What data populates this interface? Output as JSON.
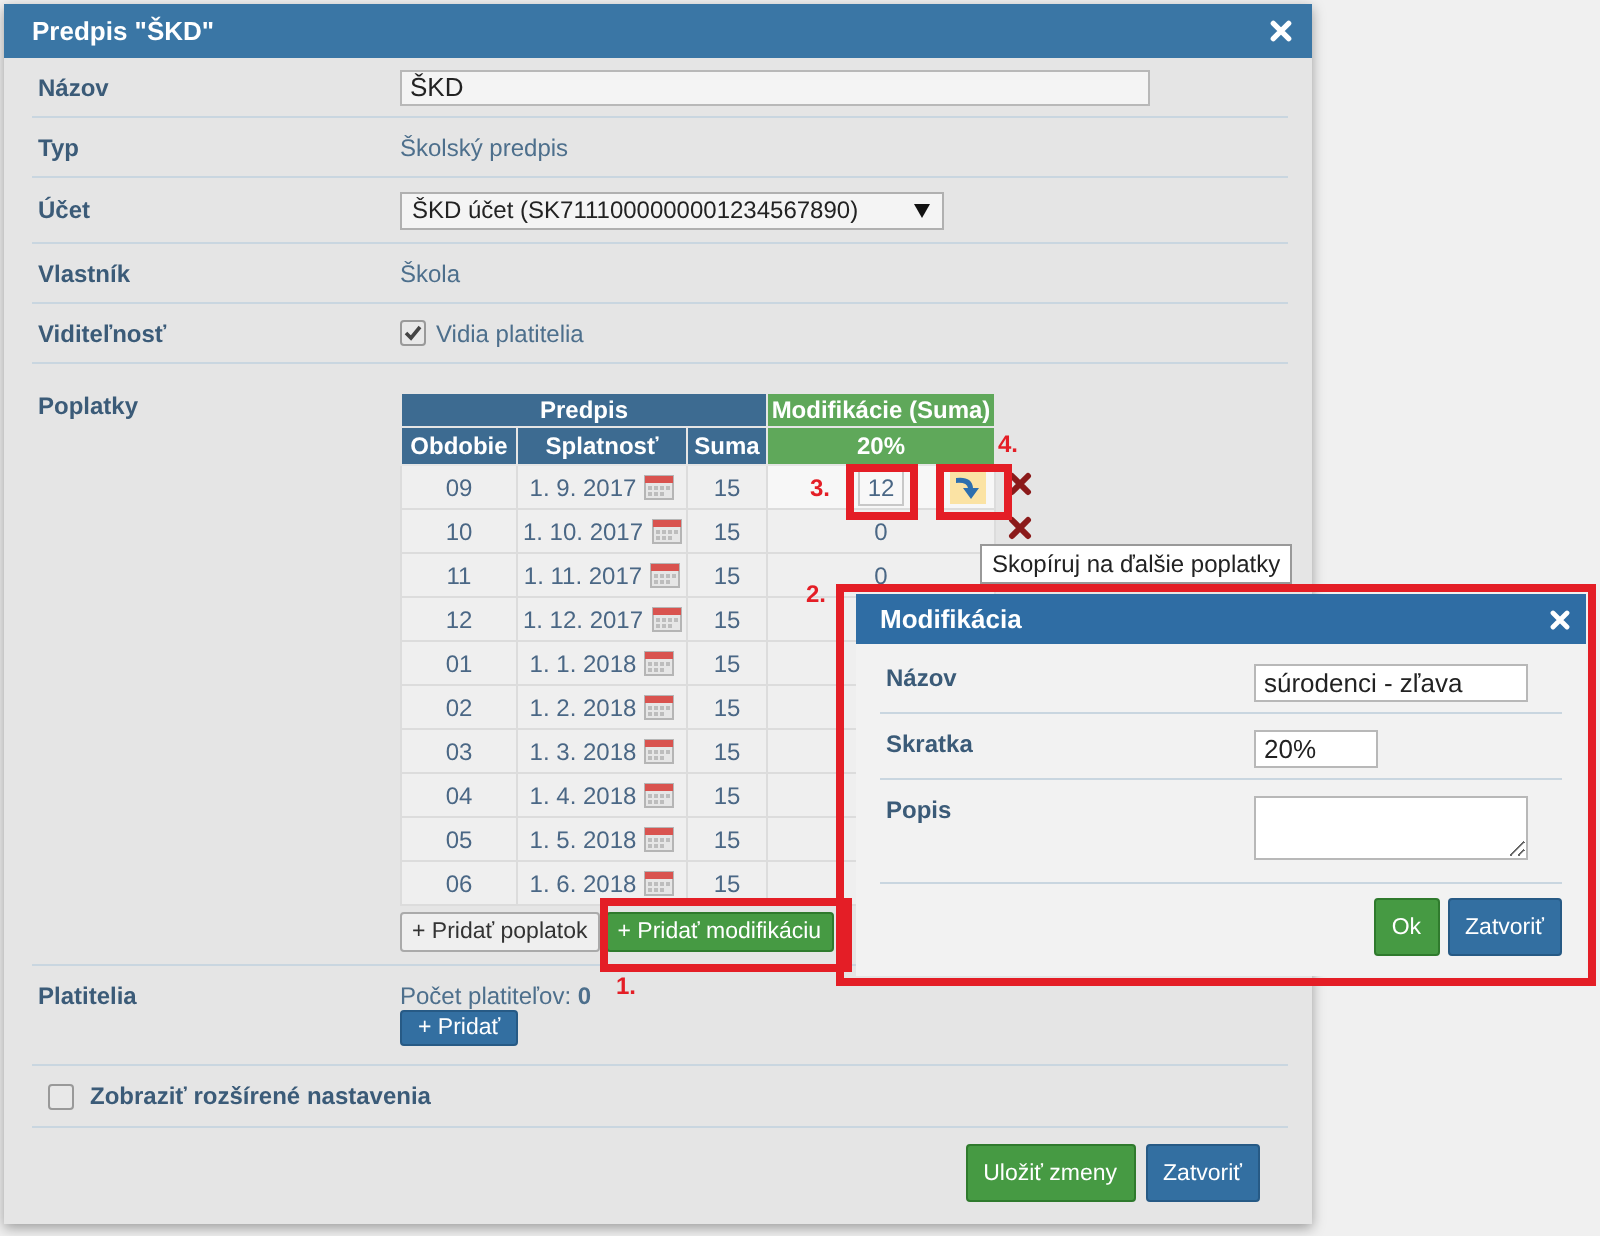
{
  "dialog": {
    "title": "Predpis \"ŠKD\"",
    "fields": [
      {
        "kind": "input",
        "label": "Názov",
        "value": "ŠKD"
      },
      {
        "kind": "text",
        "label": "Typ",
        "value": "Školský predpis"
      },
      {
        "kind": "select",
        "label": "Účet",
        "value": "ŠKD účet (SK7111000000001234567890)"
      },
      {
        "kind": "text",
        "label": "Vlastník",
        "value": "Škola"
      },
      {
        "kind": "checkbox",
        "label": "Viditeľnosť",
        "value": "Vidia platitelia",
        "checked": true
      }
    ],
    "fees": {
      "label": "Poplatky",
      "group_headers": [
        "Predpis",
        "Modifikácie (Suma)"
      ],
      "columns": [
        "Obdobie",
        "Splatnosť",
        "Suma"
      ],
      "modification_name": "20%",
      "rows": [
        {
          "period": "09",
          "due": "1. 9. 2017",
          "amount": "15",
          "modification": "12",
          "editing": true,
          "deletable": true
        },
        {
          "period": "10",
          "due": "1. 10. 2017",
          "amount": "15",
          "modification": "0",
          "editing": false,
          "deletable": true
        },
        {
          "period": "11",
          "due": "1. 11. 2017",
          "amount": "15",
          "modification": "0",
          "editing": false
        },
        {
          "period": "12",
          "due": "1. 12. 2017",
          "amount": "15"
        },
        {
          "period": "01",
          "due": "1. 1. 2018",
          "amount": "15"
        },
        {
          "period": "02",
          "due": "1. 2. 2018",
          "amount": "15"
        },
        {
          "period": "03",
          "due": "1. 3. 2018",
          "amount": "15"
        },
        {
          "period": "04",
          "due": "1. 4. 2018",
          "amount": "15"
        },
        {
          "period": "05",
          "due": "1. 5. 2018",
          "amount": "15"
        },
        {
          "period": "06",
          "due": "1. 6. 2018",
          "amount": "15"
        }
      ],
      "buttons": [
        {
          "label": "+ Pridať poplatok",
          "kind": "default"
        },
        {
          "label": "+ Pridať modifikáciu",
          "kind": "success"
        }
      ]
    },
    "payers": {
      "label": "Platitelia",
      "count_label": "Počet platiteľov:",
      "count": "0",
      "add_button": "+ Pridať"
    },
    "advanced": {
      "label": "Zobraziť rozšírené nastavenia",
      "checked": false
    },
    "footer_buttons": [
      {
        "label": "Uložiť zmeny",
        "kind": "success"
      },
      {
        "label": "Zatvoriť",
        "kind": "primary"
      }
    ]
  },
  "tooltip": "Skopíruj na ďalšie poplatky",
  "modification_dialog": {
    "title": "Modifikácia",
    "fields": [
      {
        "kind": "input",
        "label": "Názov",
        "value": "súrodenci - zľava"
      },
      {
        "kind": "short-input",
        "label": "Skratka",
        "value": "20%"
      },
      {
        "kind": "textarea",
        "label": "Popis"
      }
    ],
    "buttons": [
      {
        "label": "Ok",
        "kind": "success"
      },
      {
        "label": "Zatvoriť",
        "kind": "primary"
      }
    ]
  },
  "annotations": [
    "1.",
    "2.",
    "3.",
    "4."
  ]
}
